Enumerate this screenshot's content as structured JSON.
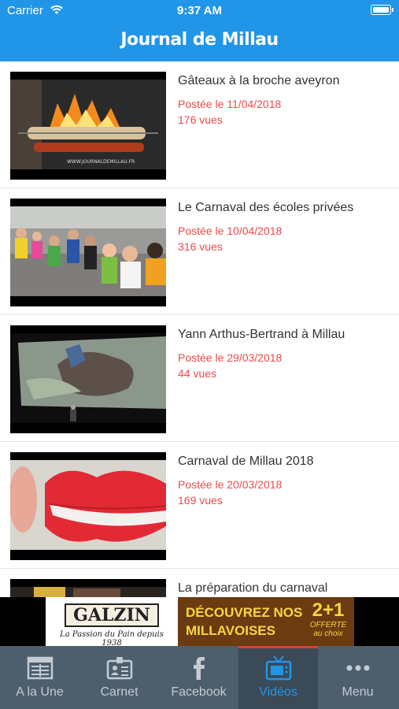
{
  "status_bar": {
    "carrier": "Carrier",
    "time": "9:37 AM"
  },
  "header": {
    "title": "Journal de Millau"
  },
  "videos": [
    {
      "title": "Gâteaux à la broche aveyron",
      "date": "Postée le 11/04/2018",
      "views": "176 vues",
      "thumb_caption": "WWW.JOURNALDEMILLAU.FR"
    },
    {
      "title": "Le Carnaval des écoles privées",
      "date": "Postée le 10/04/2018",
      "views": "316 vues"
    },
    {
      "title": "Yann Arthus-Bertrand à Millau",
      "date": "Postée le 29/03/2018",
      "views": "44 vues"
    },
    {
      "title": "Carnaval de Millau 2018",
      "date": "Postée le 20/03/2018",
      "views": "169 vues"
    },
    {
      "title": "La préparation du carnaval"
    }
  ],
  "ad": {
    "brand": "GALZIN",
    "tagline": "La Passion du Pain depuis 1938",
    "line1": "DÉCOUVREZ NOS",
    "line2": "MILLAVOISES",
    "offer": "2+1",
    "offer_sub1": "OFFERTE",
    "offer_sub2": "au choix"
  },
  "tabs": [
    {
      "label": "A la Une",
      "icon": "newspaper-icon"
    },
    {
      "label": "Carnet",
      "icon": "id-card-icon"
    },
    {
      "label": "Facebook",
      "icon": "facebook-icon"
    },
    {
      "label": "Vidéos",
      "icon": "tv-icon",
      "active": true
    },
    {
      "label": "Menu",
      "icon": "more-dots-icon"
    }
  ],
  "colors": {
    "header": "#2196e8",
    "accent_red": "#ee4a4a",
    "tabbar": "#4d5e6d",
    "tab_active_text": "#2196e8"
  }
}
